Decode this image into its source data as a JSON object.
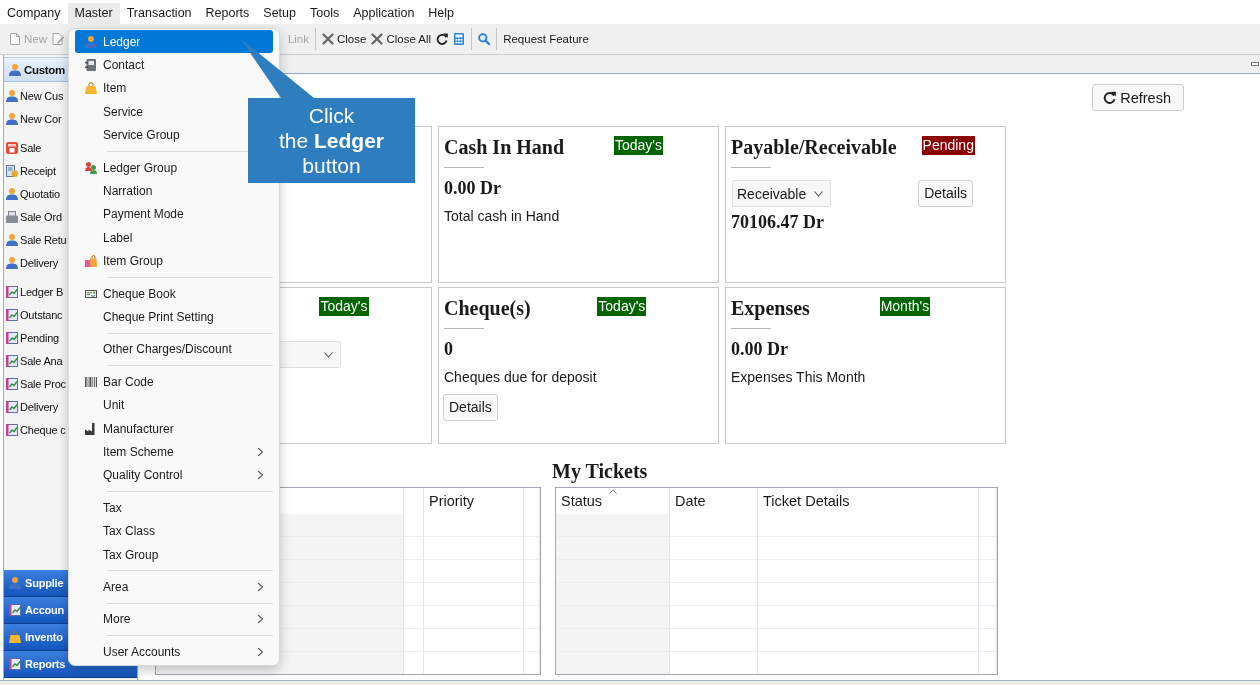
{
  "menubar": {
    "items": [
      {
        "label": "Company",
        "selected": false
      },
      {
        "label": "Master",
        "selected": true
      },
      {
        "label": "Transaction",
        "selected": false
      },
      {
        "label": "Reports",
        "selected": false
      },
      {
        "label": "Setup",
        "selected": false
      },
      {
        "label": "Tools",
        "selected": false
      },
      {
        "label": "Application",
        "selected": false
      },
      {
        "label": "Help",
        "selected": false
      }
    ]
  },
  "toolbar": {
    "groups": [
      [
        {
          "label": "New",
          "kind": "document",
          "disabled": true
        },
        {
          "kind": "edit",
          "disabled": true
        },
        {
          "label": "Link",
          "kind": "text",
          "disabled": true
        }
      ],
      [
        {
          "label": "Close",
          "kind": "close",
          "disabled": false
        },
        {
          "label": "Close All",
          "kind": "close",
          "disabled": false
        },
        {
          "kind": "refresh",
          "disabled": false
        },
        {
          "kind": "calculator",
          "disabled": false
        }
      ],
      [
        {
          "kind": "search",
          "disabled": false
        }
      ],
      [
        {
          "label": "Request Feature",
          "kind": "text",
          "disabled": false
        }
      ]
    ]
  },
  "sidebar": {
    "header": {
      "label": "Custom"
    },
    "groups": [
      [
        {
          "label": "New Cus",
          "kind": "person"
        },
        {
          "label": "New Cor",
          "kind": "person"
        }
      ],
      [
        {
          "label": "Sale",
          "kind": "store"
        },
        {
          "label": "Receipt",
          "kind": "receipt"
        },
        {
          "label": "Quotatio",
          "kind": "person"
        },
        {
          "label": "Sale Ord",
          "kind": "printer"
        },
        {
          "label": "Sale Retu",
          "kind": "person"
        },
        {
          "label": "Delivery",
          "kind": "person"
        }
      ],
      [
        {
          "label": "Ledger B",
          "kind": "report"
        },
        {
          "label": "Outstanc",
          "kind": "report"
        },
        {
          "label": "Pending",
          "kind": "report"
        },
        {
          "label": "Sale Ana",
          "kind": "report"
        },
        {
          "label": "Sale Proc",
          "kind": "report"
        },
        {
          "label": "Delivery",
          "kind": "report"
        },
        {
          "label": "Cheque c",
          "kind": "report"
        }
      ]
    ],
    "sections": [
      {
        "label": "Supplie",
        "kind": "person"
      },
      {
        "label": "Accoun",
        "kind": "report"
      },
      {
        "label": "Invento",
        "kind": "bag"
      },
      {
        "label": "Reports",
        "kind": "report"
      }
    ]
  },
  "menu": {
    "groups": [
      [
        {
          "label": "Ledger",
          "kind": "person",
          "selected": true,
          "submenu": false
        },
        {
          "label": "Contact",
          "kind": "contact",
          "selected": false,
          "submenu": false
        },
        {
          "label": "Item",
          "kind": "bag",
          "selected": false,
          "submenu": false
        },
        {
          "label": "Service",
          "kind": "plain",
          "selected": false,
          "submenu": false
        },
        {
          "label": "Service Group",
          "kind": "plain",
          "selected": false,
          "submenu": false
        }
      ],
      [
        {
          "label": "Ledger Group",
          "kind": "people",
          "selected": false,
          "submenu": false
        },
        {
          "label": "Narration",
          "kind": "plain",
          "selected": false,
          "submenu": false
        },
        {
          "label": "Payment Mode",
          "kind": "plain",
          "selected": false,
          "submenu": false
        },
        {
          "label": "Label",
          "kind": "plain",
          "selected": false,
          "submenu": false
        },
        {
          "label": "Item Group",
          "kind": "bags",
          "selected": false,
          "submenu": false
        }
      ],
      [
        {
          "label": "Cheque Book",
          "kind": "cheque",
          "selected": false,
          "submenu": false
        },
        {
          "label": "Cheque Print Setting",
          "kind": "plain",
          "selected": false,
          "submenu": false
        }
      ],
      [
        {
          "label": "Other Charges/Discount",
          "kind": "plain",
          "selected": false,
          "submenu": false
        }
      ],
      [
        {
          "label": "Bar Code",
          "kind": "barcode",
          "selected": false,
          "submenu": false
        },
        {
          "label": "Unit",
          "kind": "plain",
          "selected": false,
          "submenu": false
        },
        {
          "label": "Manufacturer",
          "kind": "factory",
          "selected": false,
          "submenu": false
        },
        {
          "label": "Item Scheme",
          "kind": "plain",
          "selected": false,
          "submenu": true
        },
        {
          "label": "Quality Control",
          "kind": "plain",
          "selected": false,
          "submenu": true
        }
      ],
      [
        {
          "label": "Tax",
          "kind": "plain",
          "selected": false,
          "submenu": false
        },
        {
          "label": "Tax Class",
          "kind": "plain",
          "selected": false,
          "submenu": false
        },
        {
          "label": "Tax Group",
          "kind": "plain",
          "selected": false,
          "submenu": false
        }
      ],
      [
        {
          "label": "Area",
          "kind": "plain",
          "selected": false,
          "submenu": true
        }
      ],
      [
        {
          "label": "More",
          "kind": "plain",
          "selected": false,
          "submenu": true
        }
      ],
      [
        {
          "label": "User Accounts",
          "kind": "plain",
          "selected": false,
          "submenu": true
        }
      ]
    ]
  },
  "callout": {
    "text": "Click\nthe **Ledger**\nbutton"
  },
  "dashboard": {
    "refresh": {
      "label": "Refresh"
    },
    "cards": [
      {
        "title": "Cash In Hand",
        "badge": {
          "text": "Today's",
          "color": "#006400"
        },
        "amount": "0.00 Dr",
        "caption": "Total cash in Hand"
      },
      {
        "title": "Payable/Receivable",
        "badge": {
          "text": "Pending",
          "color": "#8b0000"
        },
        "picker": {
          "value": "Receivable",
          "expanded": false
        },
        "action": "Details",
        "amount": "70106.47 Dr"
      },
      {
        "badge": {
          "text": "Today's",
          "color": "#006400"
        },
        "picker": {
          "expanded": false
        }
      },
      {
        "title": "Cheque(s)",
        "badge": {
          "text": "Today's",
          "color": "#006400"
        },
        "amount": "0",
        "caption": "Cheques due for deposit",
        "action": "Details"
      },
      {
        "title": "Expenses",
        "badge": {
          "text": "Month's",
          "color": "#006400"
        },
        "amount": "0.00 Dr",
        "caption": "Expenses This Month"
      }
    ],
    "task_list": {
      "columns": [
        {
          "label": "Priority",
          "sorted": false
        }
      ]
    },
    "tickets": {
      "title": "My Tickets",
      "columns": [
        {
          "label": "Status",
          "sorted": true
        },
        {
          "label": "Date",
          "sorted": false
        },
        {
          "label": "Ticket Details",
          "sorted": false
        }
      ]
    }
  }
}
